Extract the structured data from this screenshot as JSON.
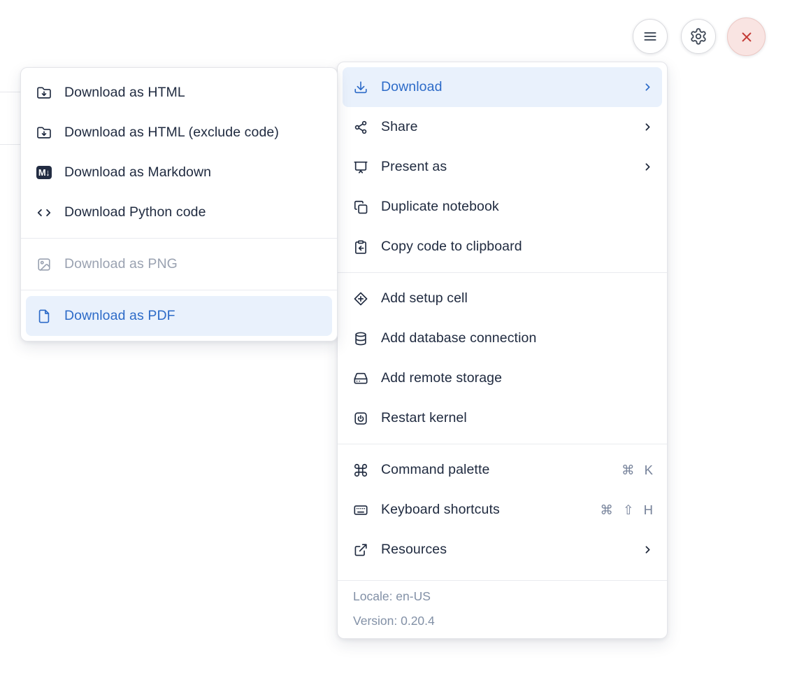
{
  "colors": {
    "accent_blue": "#2d6bc8",
    "highlight_bg": "#e9f1fc",
    "text": "#202b40",
    "disabled_text": "#9aa2b1",
    "muted_text": "#8290a6",
    "close_red": "#c43b36",
    "close_bg": "#f9e4e2"
  },
  "toolbar": {
    "buttons": [
      {
        "name": "menu",
        "icon": "hamburger-icon"
      },
      {
        "name": "settings",
        "icon": "gear-icon"
      },
      {
        "name": "close",
        "icon": "x-icon"
      }
    ]
  },
  "main_menu": {
    "groups": [
      {
        "items": [
          {
            "label": "Download",
            "icon": "download-icon",
            "trailing": "chevron",
            "state": "highlighted"
          },
          {
            "label": "Share",
            "icon": "share-icon",
            "trailing": "chevron"
          },
          {
            "label": "Present as",
            "icon": "presentation-icon",
            "trailing": "chevron"
          },
          {
            "label": "Duplicate notebook",
            "icon": "duplicate-icon"
          },
          {
            "label": "Copy code to clipboard",
            "icon": "clipboard-copy-icon"
          }
        ]
      },
      {
        "items": [
          {
            "label": "Add setup cell",
            "icon": "diamond-plus-icon"
          },
          {
            "label": "Add database connection",
            "icon": "database-icon"
          },
          {
            "label": "Add remote storage",
            "icon": "hard-drive-icon"
          },
          {
            "label": "Restart kernel",
            "icon": "power-icon"
          }
        ]
      },
      {
        "items": [
          {
            "label": "Command palette",
            "icon": "command-icon",
            "shortcut": "⌘ K"
          },
          {
            "label": "Keyboard shortcuts",
            "icon": "keyboard-icon",
            "shortcut": "⌘ ⇧ H"
          },
          {
            "label": "Resources",
            "icon": "external-link-icon",
            "trailing": "chevron"
          }
        ]
      }
    ],
    "footer": {
      "locale": "Locale: en-US",
      "version": "Version: 0.20.4"
    }
  },
  "download_submenu": {
    "groups": [
      {
        "items": [
          {
            "label": "Download as HTML",
            "icon": "folder-down-icon"
          },
          {
            "label": "Download as HTML (exclude code)",
            "icon": "folder-down-icon"
          },
          {
            "label": "Download as Markdown",
            "icon": "markdown-icon",
            "badge": "M↓"
          },
          {
            "label": "Download Python code",
            "icon": "code-icon"
          }
        ]
      },
      {
        "items": [
          {
            "label": "Download as PNG",
            "icon": "image-icon",
            "state": "disabled"
          }
        ]
      },
      {
        "items": [
          {
            "label": "Download as PDF",
            "icon": "file-icon",
            "state": "highlighted"
          }
        ]
      }
    ]
  }
}
